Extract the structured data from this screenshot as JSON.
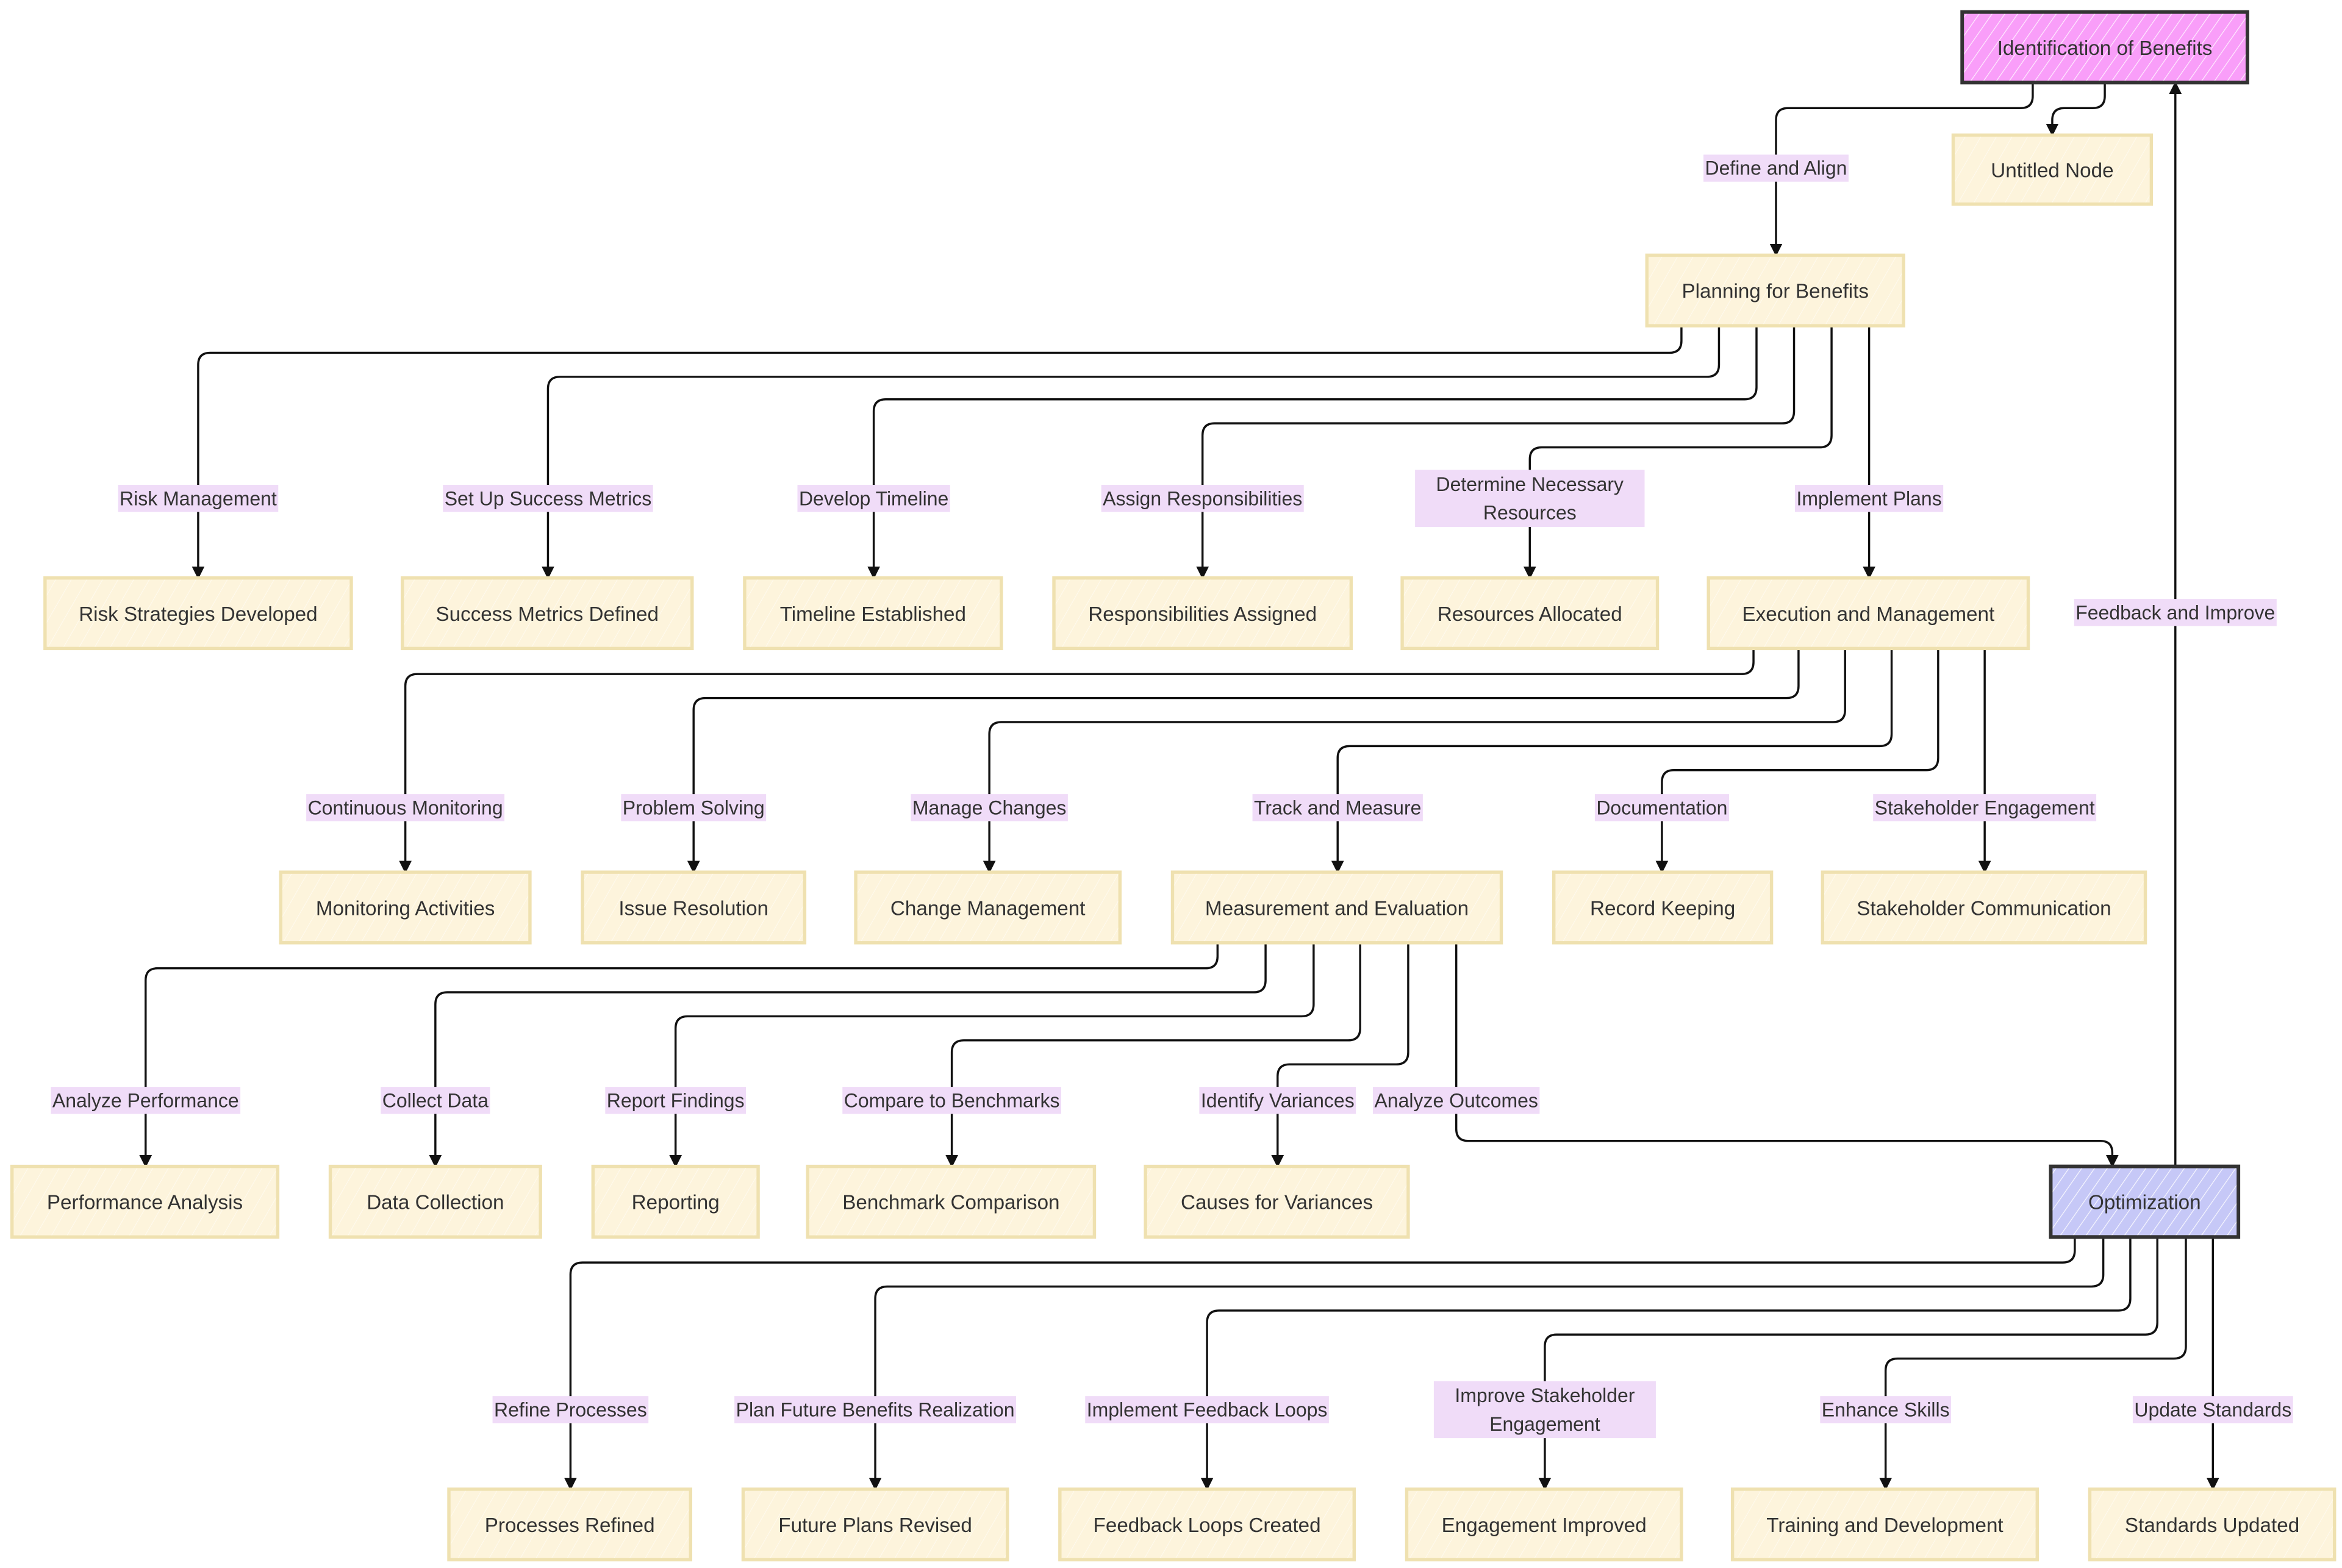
{
  "diagram": {
    "type": "flowchart",
    "colors": {
      "default_node_fill": "#fdf4dc",
      "default_node_stroke": "#efe1b0",
      "start_node_fill": "#f99ef9",
      "optimization_node_fill": "#c8c8f8",
      "highlight_stroke": "#333333",
      "edge_label_bg": "#f0dcf8",
      "edge_color": "#111111",
      "text_color": "#333333"
    },
    "nodes": [
      {
        "id": "identification",
        "label": "Identification of Benefits",
        "style": "start"
      },
      {
        "id": "untitled",
        "label": "Untitled Node",
        "style": "default"
      },
      {
        "id": "planning",
        "label": "Planning for Benefits",
        "style": "default"
      },
      {
        "id": "risk",
        "label": "Risk Strategies Developed",
        "style": "default"
      },
      {
        "id": "metrics",
        "label": "Success Metrics Defined",
        "style": "default"
      },
      {
        "id": "timeline",
        "label": "Timeline Established",
        "style": "default"
      },
      {
        "id": "responsibilities",
        "label": "Responsibilities Assigned",
        "style": "default"
      },
      {
        "id": "resources",
        "label": "Resources Allocated",
        "style": "default"
      },
      {
        "id": "execution",
        "label": "Execution and Management",
        "style": "default"
      },
      {
        "id": "monitoring",
        "label": "Monitoring Activities",
        "style": "default"
      },
      {
        "id": "issue",
        "label": "Issue Resolution",
        "style": "default"
      },
      {
        "id": "change",
        "label": "Change Management",
        "style": "default"
      },
      {
        "id": "measurement",
        "label": "Measurement and Evaluation",
        "style": "default"
      },
      {
        "id": "record",
        "label": "Record Keeping",
        "style": "default"
      },
      {
        "id": "stakeholder_comm",
        "label": "Stakeholder Communication",
        "style": "default"
      },
      {
        "id": "performance",
        "label": "Performance Analysis",
        "style": "default"
      },
      {
        "id": "data_collection",
        "label": "Data Collection",
        "style": "default"
      },
      {
        "id": "reporting",
        "label": "Reporting",
        "style": "default"
      },
      {
        "id": "benchmark",
        "label": "Benchmark Comparison",
        "style": "default"
      },
      {
        "id": "variances",
        "label": "Causes for Variances",
        "style": "default"
      },
      {
        "id": "optimization",
        "label": "Optimization",
        "style": "optimization"
      },
      {
        "id": "processes",
        "label": "Processes Refined",
        "style": "default"
      },
      {
        "id": "future",
        "label": "Future Plans Revised",
        "style": "default"
      },
      {
        "id": "feedback_loops",
        "label": "Feedback Loops Created",
        "style": "default"
      },
      {
        "id": "engagement",
        "label": "Engagement Improved",
        "style": "default"
      },
      {
        "id": "training",
        "label": "Training and Development",
        "style": "default"
      },
      {
        "id": "standards",
        "label": "Standards Updated",
        "style": "default"
      }
    ],
    "edges": [
      {
        "from": "identification",
        "to": "planning",
        "label": "Define and Align"
      },
      {
        "from": "identification",
        "to": "untitled",
        "label": ""
      },
      {
        "from": "planning",
        "to": "risk",
        "label": "Risk Management"
      },
      {
        "from": "planning",
        "to": "metrics",
        "label": "Set Up Success Metrics"
      },
      {
        "from": "planning",
        "to": "timeline",
        "label": "Develop Timeline"
      },
      {
        "from": "planning",
        "to": "responsibilities",
        "label": "Assign Responsibilities"
      },
      {
        "from": "planning",
        "to": "resources",
        "label": [
          "Determine Necessary",
          "Resources"
        ]
      },
      {
        "from": "planning",
        "to": "execution",
        "label": "Implement Plans"
      },
      {
        "from": "execution",
        "to": "monitoring",
        "label": "Continuous Monitoring"
      },
      {
        "from": "execution",
        "to": "issue",
        "label": "Problem Solving"
      },
      {
        "from": "execution",
        "to": "change",
        "label": "Manage Changes"
      },
      {
        "from": "execution",
        "to": "measurement",
        "label": "Track and Measure"
      },
      {
        "from": "execution",
        "to": "record",
        "label": "Documentation"
      },
      {
        "from": "execution",
        "to": "stakeholder_comm",
        "label": "Stakeholder Engagement"
      },
      {
        "from": "measurement",
        "to": "performance",
        "label": "Analyze Performance"
      },
      {
        "from": "measurement",
        "to": "data_collection",
        "label": "Collect Data"
      },
      {
        "from": "measurement",
        "to": "reporting",
        "label": "Report Findings"
      },
      {
        "from": "measurement",
        "to": "benchmark",
        "label": "Compare to Benchmarks"
      },
      {
        "from": "measurement",
        "to": "variances",
        "label": "Identify Variances"
      },
      {
        "from": "measurement",
        "to": "optimization",
        "label": "Analyze Outcomes"
      },
      {
        "from": "optimization",
        "to": "identification",
        "label": "Feedback and Improve"
      },
      {
        "from": "optimization",
        "to": "processes",
        "label": "Refine Processes"
      },
      {
        "from": "optimization",
        "to": "future",
        "label": "Plan Future Benefits Realization"
      },
      {
        "from": "optimization",
        "to": "feedback_loops",
        "label": "Implement Feedback Loops"
      },
      {
        "from": "optimization",
        "to": "engagement",
        "label": [
          "Improve Stakeholder",
          "Engagement"
        ]
      },
      {
        "from": "optimization",
        "to": "training",
        "label": "Enhance Skills"
      },
      {
        "from": "optimization",
        "to": "standards",
        "label": "Update Standards"
      }
    ]
  }
}
